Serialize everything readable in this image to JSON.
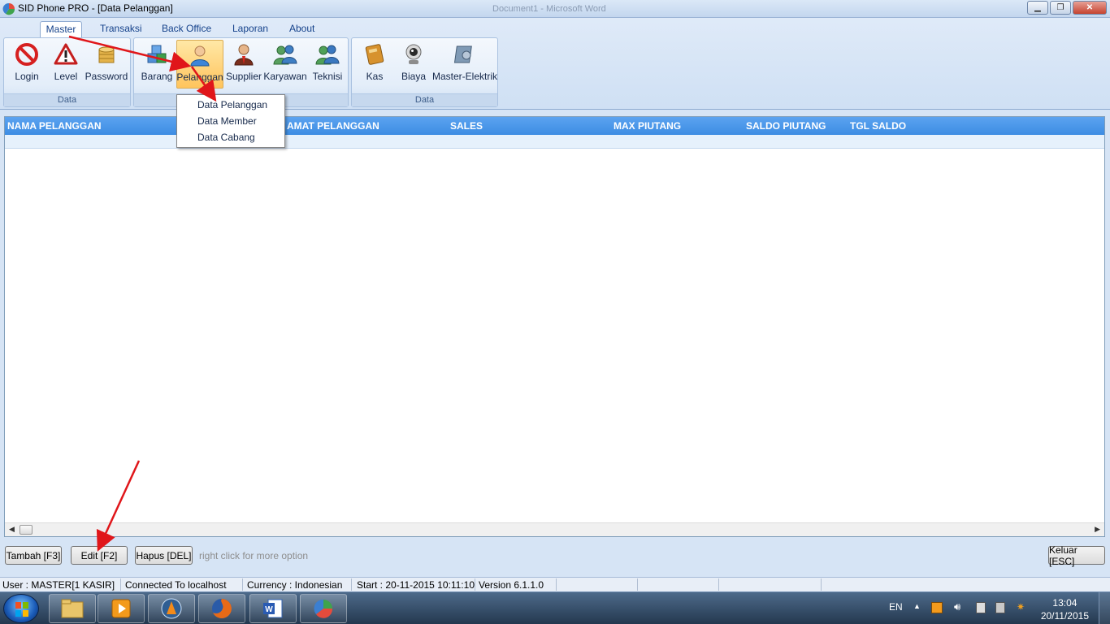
{
  "window": {
    "title": "SID Phone PRO - [Data Pelanggan]",
    "background_title": "Document1 - Microsoft Word",
    "minimize": "▁",
    "maximize": "❐",
    "close": "✕"
  },
  "ribbon": {
    "tabs": [
      "Master",
      "Transaksi",
      "Back Office",
      "Laporan",
      "About"
    ],
    "active_tab": "Master",
    "groups": [
      {
        "label": "Data",
        "buttons": [
          {
            "label": "Login",
            "icon": "no-entry-icon"
          },
          {
            "label": "Level",
            "icon": "warning-icon"
          },
          {
            "label": "Password",
            "icon": "database-icon"
          }
        ]
      },
      {
        "label": "",
        "buttons": [
          {
            "label": "Barang",
            "icon": "boxes-icon"
          },
          {
            "label": "Pelanggan",
            "icon": "customer-icon",
            "state": "hot"
          },
          {
            "label": "Supplier",
            "icon": "supplier-icon"
          },
          {
            "label": "Karyawan",
            "icon": "employees-icon"
          },
          {
            "label": "Teknisi",
            "icon": "technicians-icon"
          }
        ]
      },
      {
        "label": "Data",
        "buttons": [
          {
            "label": "Kas",
            "icon": "book-icon"
          },
          {
            "label": "Biaya",
            "icon": "webcam-icon"
          },
          {
            "label": "Master-Elektrik",
            "icon": "gear-tool-icon"
          }
        ]
      }
    ]
  },
  "dropdown": {
    "items": [
      "Data Pelanggan",
      "Data Member",
      "Data Cabang"
    ]
  },
  "grid": {
    "columns": [
      "NAMA PELANGGAN",
      "AMAT PELANGGAN",
      "SALES",
      "MAX PIUTANG",
      "SALDO PIUTANG",
      "TGL SALDO"
    ],
    "rows": []
  },
  "buttons": {
    "add": "Tambah [F3]",
    "edit": "Edit [F2]",
    "delete": "Hapus [DEL]",
    "hint": "right click for more option",
    "exit": "Keluar [ESC]"
  },
  "statusbar": {
    "user": "User : MASTER[1 KASIR]",
    "connection": "Connected To localhost",
    "currency": "Currency : Indonesian",
    "start": "Start  : 20-11-2015 10:11:10",
    "version": "Version 6.1.1.0"
  },
  "taskbar": {
    "language": "EN",
    "time": "13:04",
    "date": "20/11/2015",
    "apps": [
      "explorer-icon",
      "media-player-icon",
      "vlc-icon",
      "firefox-icon",
      "word-icon",
      "pie-chart-app-icon"
    ]
  }
}
